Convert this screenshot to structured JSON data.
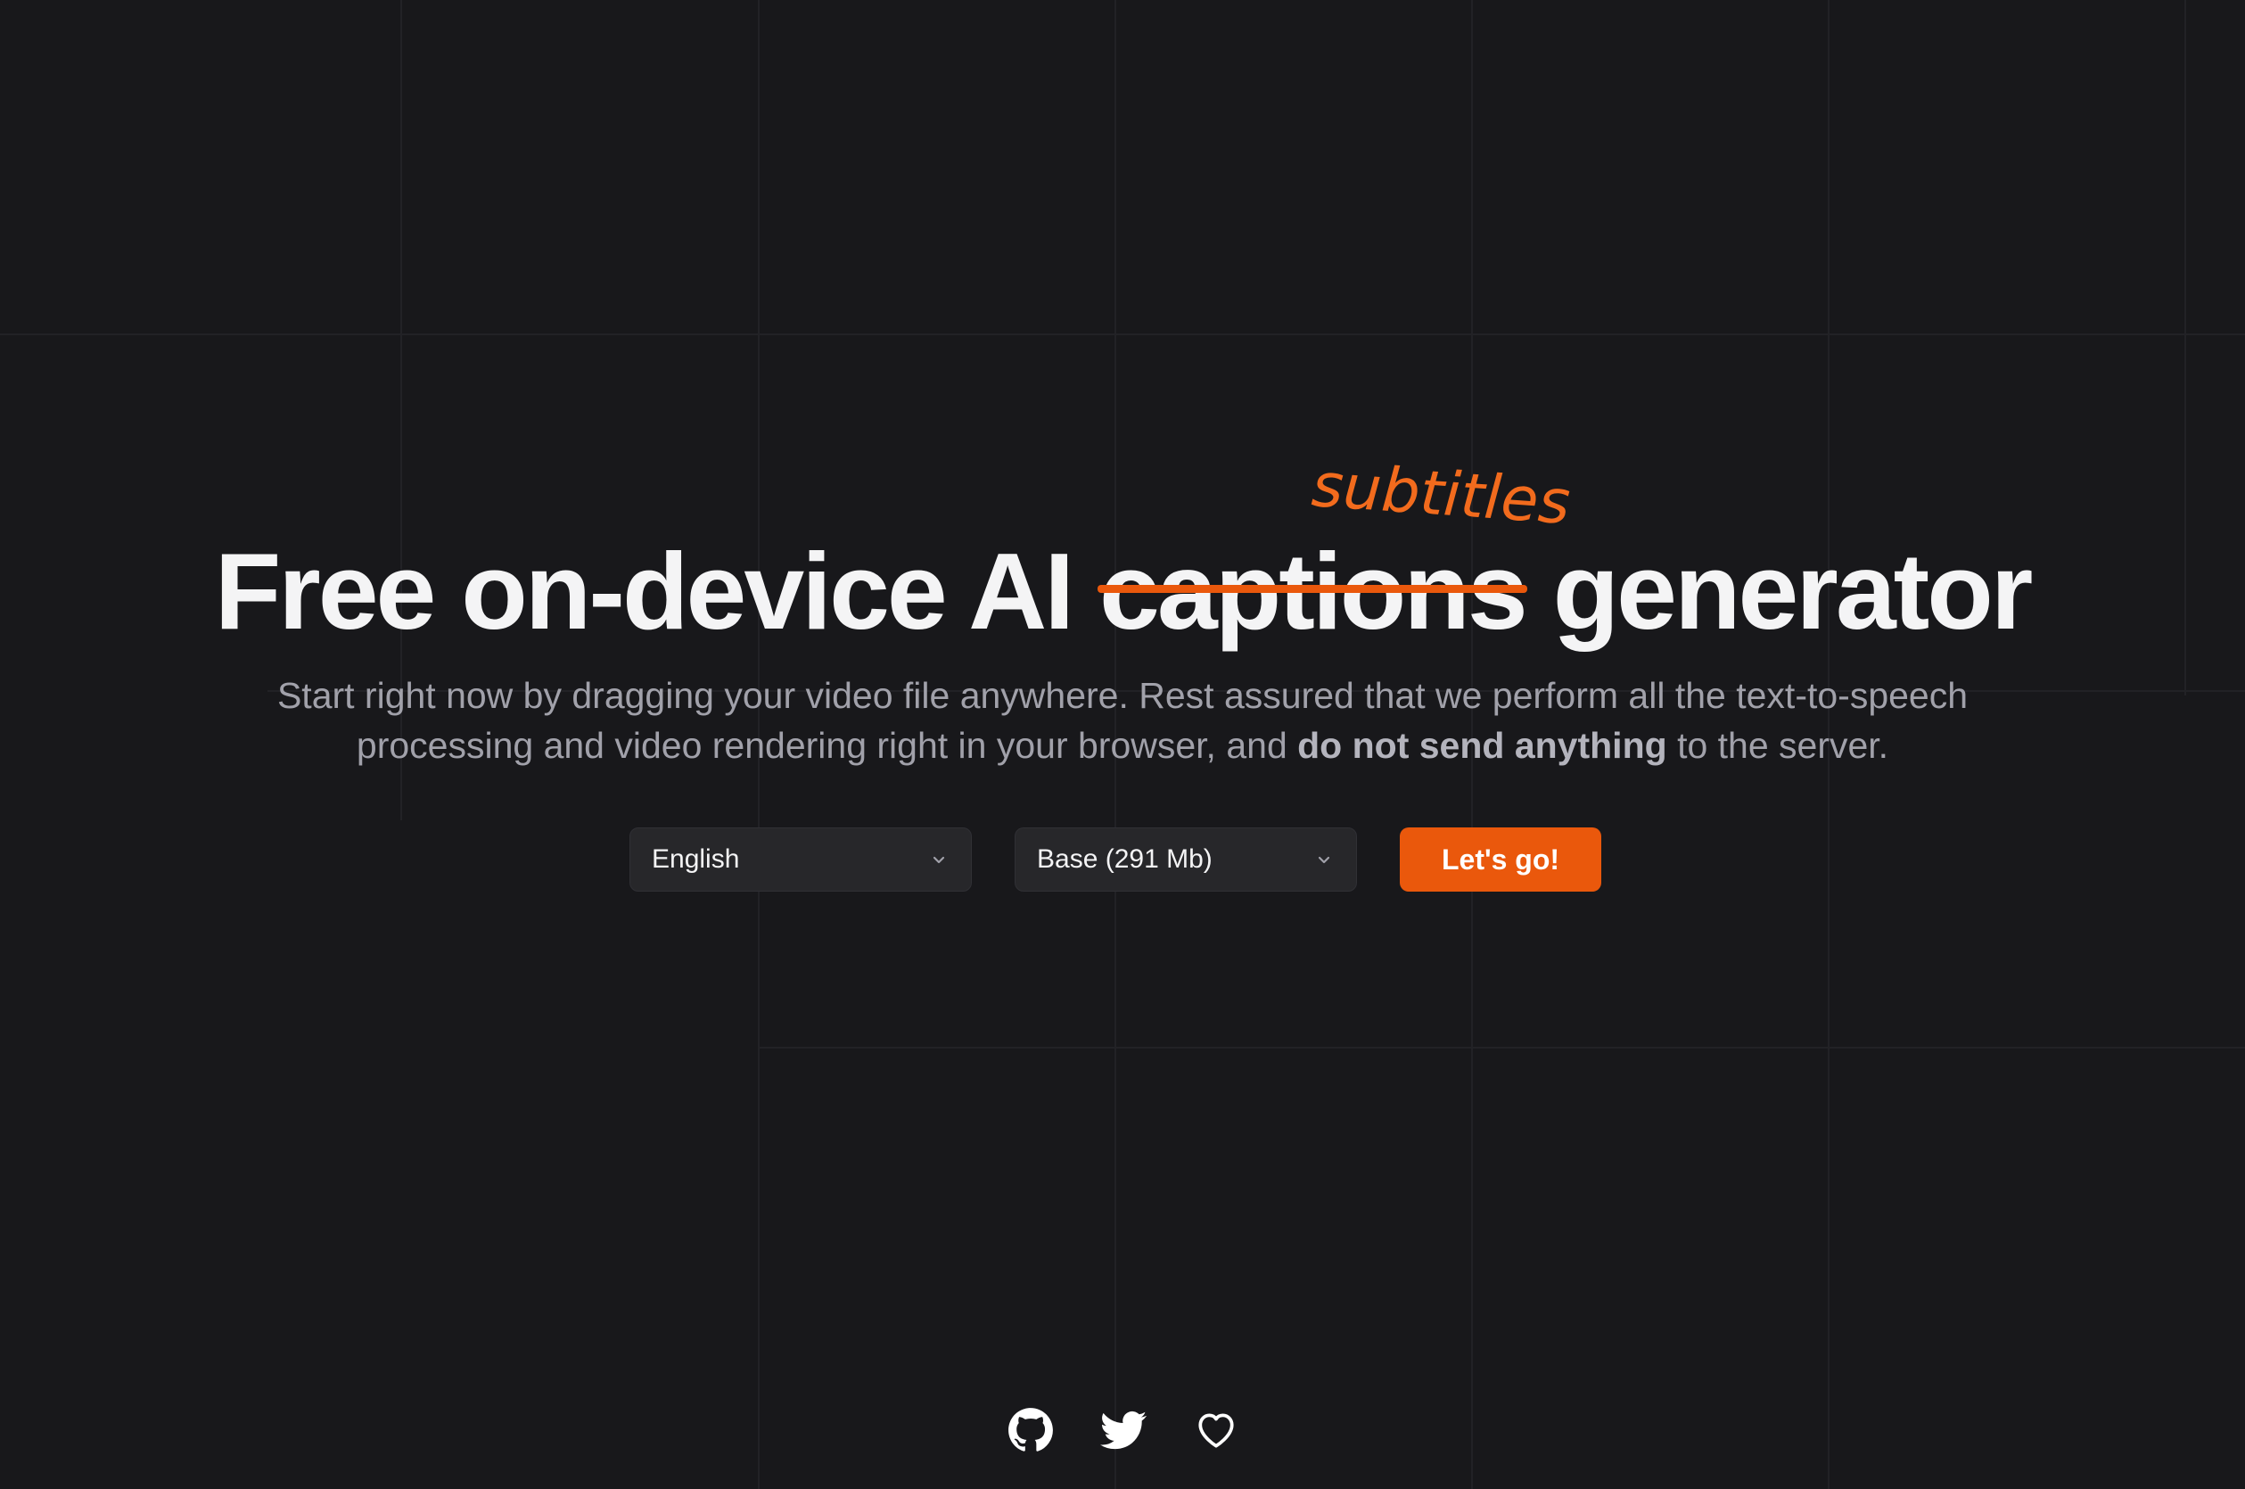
{
  "hero": {
    "headline_before": "Free on-device AI ",
    "headline_struck": "captions",
    "headline_after": " generator",
    "replacement_word": "subtitles",
    "subtext_before": "Start right now by dragging your video file anywhere. Rest assured that we perform all the text-to-speech processing and video rendering right in your browser, and ",
    "subtext_bold": "do not send anything",
    "subtext_after": " to the server."
  },
  "controls": {
    "language_select": {
      "selected": "English",
      "icon": "chevron-down-icon"
    },
    "model_select": {
      "selected": "Base (291 Mb)",
      "icon": "chevron-down-icon"
    },
    "go_button_label": "Let's go!"
  },
  "footer": {
    "links": [
      {
        "icon": "github-icon"
      },
      {
        "icon": "twitter-icon"
      },
      {
        "icon": "heart-icon"
      }
    ]
  },
  "colors": {
    "background": "#18181b",
    "accent": "#ea580c",
    "headline": "#f4f4f5",
    "subtext": "#a1a1aa",
    "select_bg": "#27272a"
  }
}
